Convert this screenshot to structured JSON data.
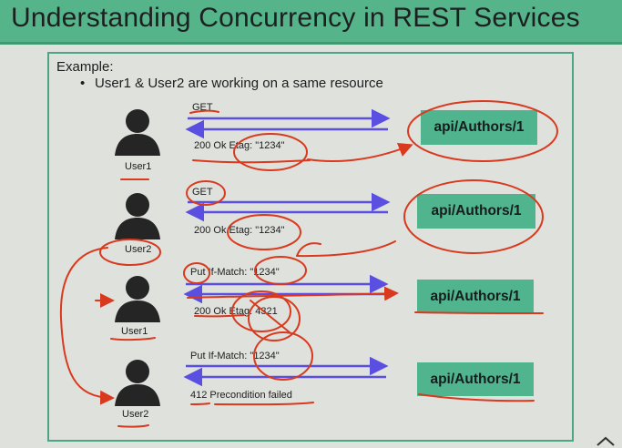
{
  "slide": {
    "title": "Understanding Concurrency in REST Services",
    "example_label": "Example:",
    "bullet": "•",
    "bullet_text": "User1 & User2 are working on a same resource"
  },
  "scenarios": [
    {
      "user": "User1",
      "request": "GET",
      "response": "200 Ok Etag: \"1234\"",
      "resource": "api/Authors/1"
    },
    {
      "user": "User2",
      "request": "GET",
      "response": "200 Ok Etag: \"1234\"",
      "resource": "api/Authors/1"
    },
    {
      "user": "User1",
      "request": "Put  If-Match: \"1234\"",
      "response": "200 Ok  Etag: 4321",
      "resource": "api/Authors/1"
    },
    {
      "user": "User2",
      "request": "Put  If-Match: \"1234\"",
      "response": "412 Precondition failed",
      "resource": "api/Authors/1"
    }
  ],
  "colors": {
    "title_bar": "#56b48a",
    "resource_box": "#50b48f",
    "arrow": "#5a4fe0",
    "annotation": "#d9391d",
    "person": "#252525"
  },
  "icons": [
    "person-icon",
    "chevron-up-icon"
  ]
}
